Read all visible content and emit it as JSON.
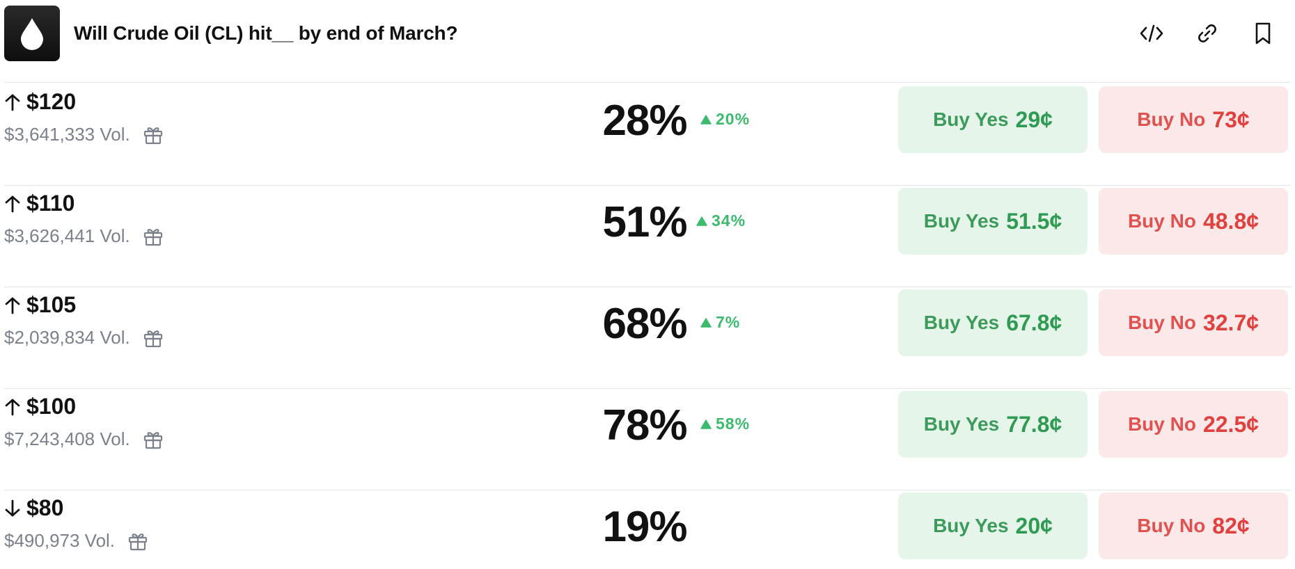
{
  "header": {
    "title": "Will Crude Oil (CL) hit__ by end of March?",
    "icons": [
      "drop-icon",
      "embed-code-icon",
      "link-icon",
      "bookmark-icon"
    ]
  },
  "colors": {
    "yes_text": "#3c9a5b",
    "yes_bg": "#e6f5ea",
    "no_text": "#e0403e",
    "no_bg": "#fbe8e8",
    "change_up": "#3cba6e",
    "muted": "#7b818a"
  },
  "rows": [
    {
      "direction": "up",
      "label": "$120",
      "volume": "$3,641,333 Vol.",
      "percent": "28%",
      "change": "20%",
      "yes_label": "Buy Yes",
      "yes_price": "29¢",
      "no_label": "Buy No",
      "no_price": "73¢"
    },
    {
      "direction": "up",
      "label": "$110",
      "volume": "$3,626,441 Vol.",
      "percent": "51%",
      "change": "34%",
      "yes_label": "Buy Yes",
      "yes_price": "51.5¢",
      "no_label": "Buy No",
      "no_price": "48.8¢"
    },
    {
      "direction": "up",
      "label": "$105",
      "volume": "$2,039,834 Vol.",
      "percent": "68%",
      "change": "7%",
      "yes_label": "Buy Yes",
      "yes_price": "67.8¢",
      "no_label": "Buy No",
      "no_price": "32.7¢"
    },
    {
      "direction": "up",
      "label": "$100",
      "volume": "$7,243,408 Vol.",
      "percent": "78%",
      "change": "58%",
      "yes_label": "Buy Yes",
      "yes_price": "77.8¢",
      "no_label": "Buy No",
      "no_price": "22.5¢"
    },
    {
      "direction": "down",
      "label": "$80",
      "volume": "$490,973 Vol.",
      "percent": "19%",
      "change": "",
      "yes_label": "Buy Yes",
      "yes_price": "20¢",
      "no_label": "Buy No",
      "no_price": "82¢"
    }
  ]
}
